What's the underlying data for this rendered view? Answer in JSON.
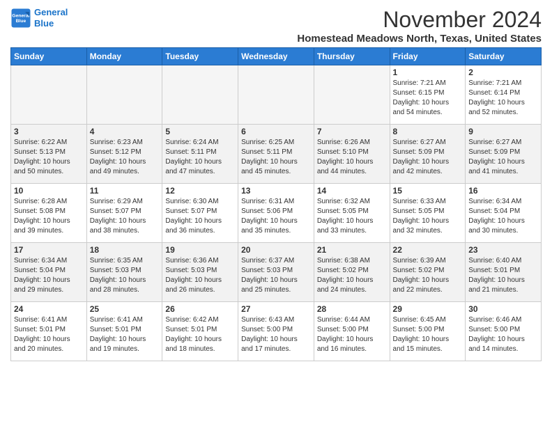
{
  "header": {
    "logo_line1": "General",
    "logo_line2": "Blue",
    "title": "November 2024",
    "subtitle": "Homestead Meadows North, Texas, United States"
  },
  "days_of_week": [
    "Sunday",
    "Monday",
    "Tuesday",
    "Wednesday",
    "Thursday",
    "Friday",
    "Saturday"
  ],
  "weeks": [
    [
      {
        "day": "",
        "info": ""
      },
      {
        "day": "",
        "info": ""
      },
      {
        "day": "",
        "info": ""
      },
      {
        "day": "",
        "info": ""
      },
      {
        "day": "",
        "info": ""
      },
      {
        "day": "1",
        "info": "Sunrise: 7:21 AM\nSunset: 6:15 PM\nDaylight: 10 hours and 54 minutes."
      },
      {
        "day": "2",
        "info": "Sunrise: 7:21 AM\nSunset: 6:14 PM\nDaylight: 10 hours and 52 minutes."
      }
    ],
    [
      {
        "day": "3",
        "info": "Sunrise: 6:22 AM\nSunset: 5:13 PM\nDaylight: 10 hours and 50 minutes."
      },
      {
        "day": "4",
        "info": "Sunrise: 6:23 AM\nSunset: 5:12 PM\nDaylight: 10 hours and 49 minutes."
      },
      {
        "day": "5",
        "info": "Sunrise: 6:24 AM\nSunset: 5:11 PM\nDaylight: 10 hours and 47 minutes."
      },
      {
        "day": "6",
        "info": "Sunrise: 6:25 AM\nSunset: 5:11 PM\nDaylight: 10 hours and 45 minutes."
      },
      {
        "day": "7",
        "info": "Sunrise: 6:26 AM\nSunset: 5:10 PM\nDaylight: 10 hours and 44 minutes."
      },
      {
        "day": "8",
        "info": "Sunrise: 6:27 AM\nSunset: 5:09 PM\nDaylight: 10 hours and 42 minutes."
      },
      {
        "day": "9",
        "info": "Sunrise: 6:27 AM\nSunset: 5:09 PM\nDaylight: 10 hours and 41 minutes."
      }
    ],
    [
      {
        "day": "10",
        "info": "Sunrise: 6:28 AM\nSunset: 5:08 PM\nDaylight: 10 hours and 39 minutes."
      },
      {
        "day": "11",
        "info": "Sunrise: 6:29 AM\nSunset: 5:07 PM\nDaylight: 10 hours and 38 minutes."
      },
      {
        "day": "12",
        "info": "Sunrise: 6:30 AM\nSunset: 5:07 PM\nDaylight: 10 hours and 36 minutes."
      },
      {
        "day": "13",
        "info": "Sunrise: 6:31 AM\nSunset: 5:06 PM\nDaylight: 10 hours and 35 minutes."
      },
      {
        "day": "14",
        "info": "Sunrise: 6:32 AM\nSunset: 5:05 PM\nDaylight: 10 hours and 33 minutes."
      },
      {
        "day": "15",
        "info": "Sunrise: 6:33 AM\nSunset: 5:05 PM\nDaylight: 10 hours and 32 minutes."
      },
      {
        "day": "16",
        "info": "Sunrise: 6:34 AM\nSunset: 5:04 PM\nDaylight: 10 hours and 30 minutes."
      }
    ],
    [
      {
        "day": "17",
        "info": "Sunrise: 6:34 AM\nSunset: 5:04 PM\nDaylight: 10 hours and 29 minutes."
      },
      {
        "day": "18",
        "info": "Sunrise: 6:35 AM\nSunset: 5:03 PM\nDaylight: 10 hours and 28 minutes."
      },
      {
        "day": "19",
        "info": "Sunrise: 6:36 AM\nSunset: 5:03 PM\nDaylight: 10 hours and 26 minutes."
      },
      {
        "day": "20",
        "info": "Sunrise: 6:37 AM\nSunset: 5:03 PM\nDaylight: 10 hours and 25 minutes."
      },
      {
        "day": "21",
        "info": "Sunrise: 6:38 AM\nSunset: 5:02 PM\nDaylight: 10 hours and 24 minutes."
      },
      {
        "day": "22",
        "info": "Sunrise: 6:39 AM\nSunset: 5:02 PM\nDaylight: 10 hours and 22 minutes."
      },
      {
        "day": "23",
        "info": "Sunrise: 6:40 AM\nSunset: 5:01 PM\nDaylight: 10 hours and 21 minutes."
      }
    ],
    [
      {
        "day": "24",
        "info": "Sunrise: 6:41 AM\nSunset: 5:01 PM\nDaylight: 10 hours and 20 minutes."
      },
      {
        "day": "25",
        "info": "Sunrise: 6:41 AM\nSunset: 5:01 PM\nDaylight: 10 hours and 19 minutes."
      },
      {
        "day": "26",
        "info": "Sunrise: 6:42 AM\nSunset: 5:01 PM\nDaylight: 10 hours and 18 minutes."
      },
      {
        "day": "27",
        "info": "Sunrise: 6:43 AM\nSunset: 5:00 PM\nDaylight: 10 hours and 17 minutes."
      },
      {
        "day": "28",
        "info": "Sunrise: 6:44 AM\nSunset: 5:00 PM\nDaylight: 10 hours and 16 minutes."
      },
      {
        "day": "29",
        "info": "Sunrise: 6:45 AM\nSunset: 5:00 PM\nDaylight: 10 hours and 15 minutes."
      },
      {
        "day": "30",
        "info": "Sunrise: 6:46 AM\nSunset: 5:00 PM\nDaylight: 10 hours and 14 minutes."
      }
    ]
  ]
}
